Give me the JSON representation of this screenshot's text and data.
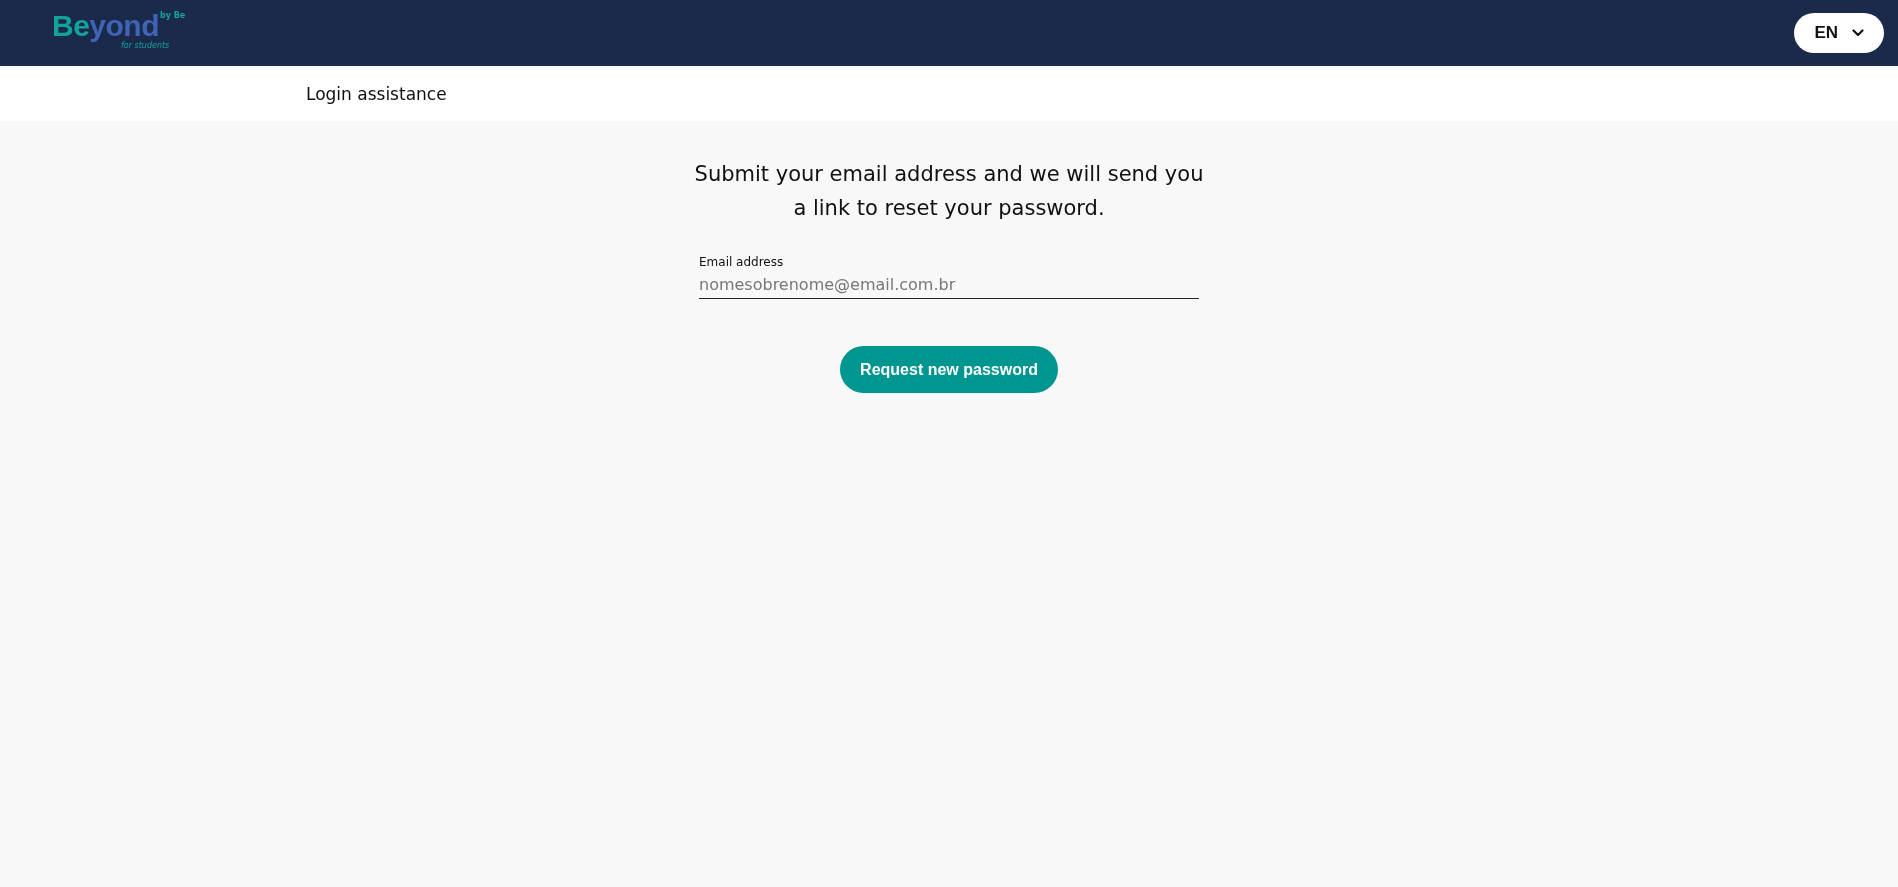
{
  "header": {
    "logo": {
      "wordmark": [
        "Be",
        "yond"
      ],
      "tag": "by Be",
      "subtitle": "for students"
    },
    "language": "EN"
  },
  "subheader": {
    "title": "Login assistance"
  },
  "form": {
    "heading": "Submit your email address and we will send you a link to reset your password.",
    "email": {
      "label": "Email address",
      "placeholder": "nomesobrenome@email.com.br"
    },
    "button": "Request new password"
  }
}
